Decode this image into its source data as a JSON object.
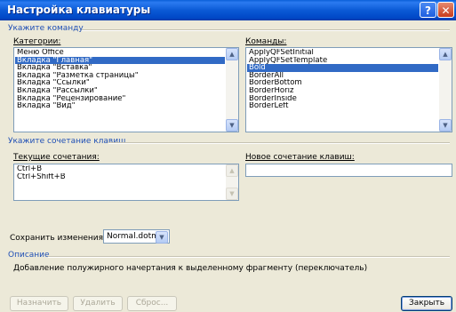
{
  "dialog": {
    "title": "Настройка клавиатуры"
  },
  "specify_command": {
    "section_label": "Укажите команду",
    "categories_label": "Категории:",
    "categories": [
      {
        "label": "Меню Office",
        "selected": false
      },
      {
        "label": "Вкладка \"Главная\"",
        "selected": true
      },
      {
        "label": "Вкладка \"Вставка\"",
        "selected": false
      },
      {
        "label": "Вкладка \"Разметка страницы\"",
        "selected": false
      },
      {
        "label": "Вкладка \"Ссылки\"",
        "selected": false
      },
      {
        "label": "Вкладка \"Рассылки\"",
        "selected": false
      },
      {
        "label": "Вкладка \"Рецензирование\"",
        "selected": false
      },
      {
        "label": "Вкладка \"Вид\"",
        "selected": false
      }
    ],
    "commands_label": "Команды:",
    "commands": [
      {
        "label": "ApplyQFSetInitial",
        "selected": false
      },
      {
        "label": "ApplyQFSetTemplate",
        "selected": false
      },
      {
        "label": "Bold",
        "selected": true
      },
      {
        "label": "BorderAll",
        "selected": false
      },
      {
        "label": "BorderBottom",
        "selected": false
      },
      {
        "label": "BorderHoriz",
        "selected": false
      },
      {
        "label": "BorderInside",
        "selected": false
      },
      {
        "label": "BorderLeft",
        "selected": false
      }
    ]
  },
  "shortcut": {
    "section_label": "Укажите сочетание клавиш",
    "current_label": "Текущие сочетания:",
    "current_items": [
      "Ctrl+B",
      "Ctrl+Shift+B"
    ],
    "new_label": "Новое сочетание клавиш:",
    "new_value": ""
  },
  "save": {
    "label": "Сохранить изменения в:",
    "value": "Normal.dotm"
  },
  "description": {
    "section_label": "Описание",
    "text": "Добавление полужирного начертания к выделенному фрагменту (переключатель)"
  },
  "buttons": {
    "assign": "Назначить",
    "remove": "Удалить",
    "reset": "Сброс...",
    "close": "Закрыть"
  },
  "colors": {
    "titlebar": "#0a5fd8",
    "section_label": "#1f4fb5",
    "selection": "#316ac5",
    "dialog_bg": "#ece9d8"
  },
  "icons": {
    "help": "question-mark",
    "close": "x"
  }
}
